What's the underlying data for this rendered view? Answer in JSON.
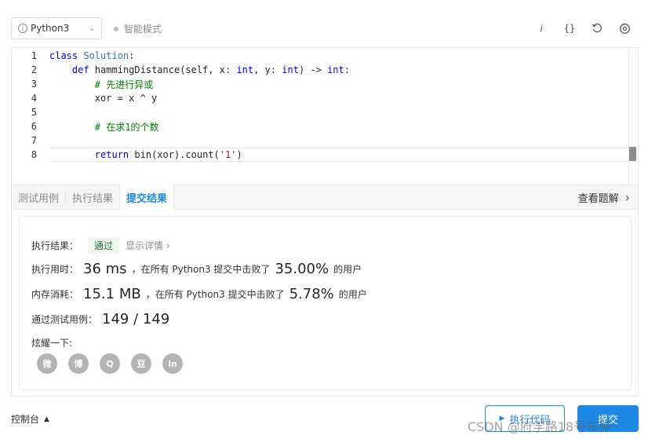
{
  "toolbar": {
    "language": "Python3",
    "info_glyph": "i",
    "mode_label": "智能模式",
    "icons": [
      "info-italic-icon",
      "braces-icon",
      "reset-icon",
      "settings-icon"
    ]
  },
  "editor": {
    "lines": [
      {
        "n": "1",
        "parts": [
          [
            "kw",
            "class"
          ],
          [
            "",
            ""
          ],
          [
            "cls",
            " Solution"
          ],
          [
            "",
            ":"
          ]
        ]
      },
      {
        "n": "2",
        "parts": [
          [
            "",
            "    "
          ],
          [
            "kw",
            "def"
          ],
          [
            "",
            " hammingDistance(self, x: "
          ],
          [
            "kw",
            "int"
          ],
          [
            "",
            ", y: "
          ],
          [
            "kw",
            "int"
          ],
          [
            "",
            ") -> "
          ],
          [
            "kw",
            "int"
          ],
          [
            "",
            ":"
          ]
        ]
      },
      {
        "n": "3",
        "parts": [
          [
            "",
            "        "
          ],
          [
            "cm",
            "# 先进行异或"
          ]
        ]
      },
      {
        "n": "4",
        "parts": [
          [
            "",
            "        xor = x ^ y"
          ]
        ]
      },
      {
        "n": "5",
        "parts": [
          [
            "",
            ""
          ]
        ]
      },
      {
        "n": "6",
        "parts": [
          [
            "",
            "        "
          ],
          [
            "cm",
            "# 在求1的个数"
          ]
        ]
      },
      {
        "n": "7",
        "parts": [
          [
            "",
            ""
          ]
        ]
      },
      {
        "n": "8",
        "parts": [
          [
            "",
            "        "
          ],
          [
            "kw",
            "return"
          ],
          [
            "",
            " bin(xor).count("
          ],
          [
            "str",
            "'1'"
          ],
          [
            "",
            ")"
          ]
        ]
      }
    ]
  },
  "tabs": {
    "items": [
      "测试用例",
      "执行结果",
      "提交结果"
    ],
    "active": 2,
    "solution_link": "查看题解"
  },
  "result": {
    "status_label": "执行结果：",
    "status_value": "通过",
    "detail_link": "显示详情",
    "time_label": "执行用时：",
    "time_value": "36 ms",
    "time_mid": "，在所有 Python3 提交中击败了",
    "time_pct": "35.00%",
    "time_tail": "的用户",
    "mem_label": "内存消耗：",
    "mem_value": "15.1 MB",
    "mem_mid": "，在所有 Python3 提交中击败了",
    "mem_pct": "5.78%",
    "mem_tail": "的用户",
    "cases_label": "通过测试用例：",
    "cases_value": "149 / 149",
    "share_label": "炫耀一下:",
    "share_icons": [
      {
        "name": "wechat-icon",
        "glyph": "微"
      },
      {
        "name": "weibo-icon",
        "glyph": "博"
      },
      {
        "name": "qq-icon",
        "glyph": "Q"
      },
      {
        "name": "douban-icon",
        "glyph": "豆"
      },
      {
        "name": "linkedin-icon",
        "glyph": "in"
      }
    ]
  },
  "bottom": {
    "console_label": "控制台",
    "run_label": "执行代码",
    "submit_label": "提交",
    "watermark": "CSDN @府学路18号车神"
  }
}
